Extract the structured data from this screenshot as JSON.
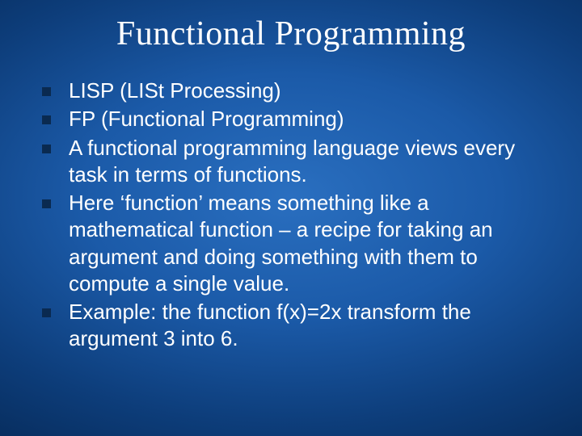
{
  "slide": {
    "title": "Functional Programming",
    "bullets": [
      "LISP (LISt Processing)",
      "FP (Functional Programming)",
      "A functional programming language views every task in terms of functions.",
      "Here ‘function’ means something like a mathematical function – a recipe for taking an argument and doing something with them to compute a single value.",
      "Example: the function f(x)=2x transform the argument 3 into 6."
    ]
  }
}
